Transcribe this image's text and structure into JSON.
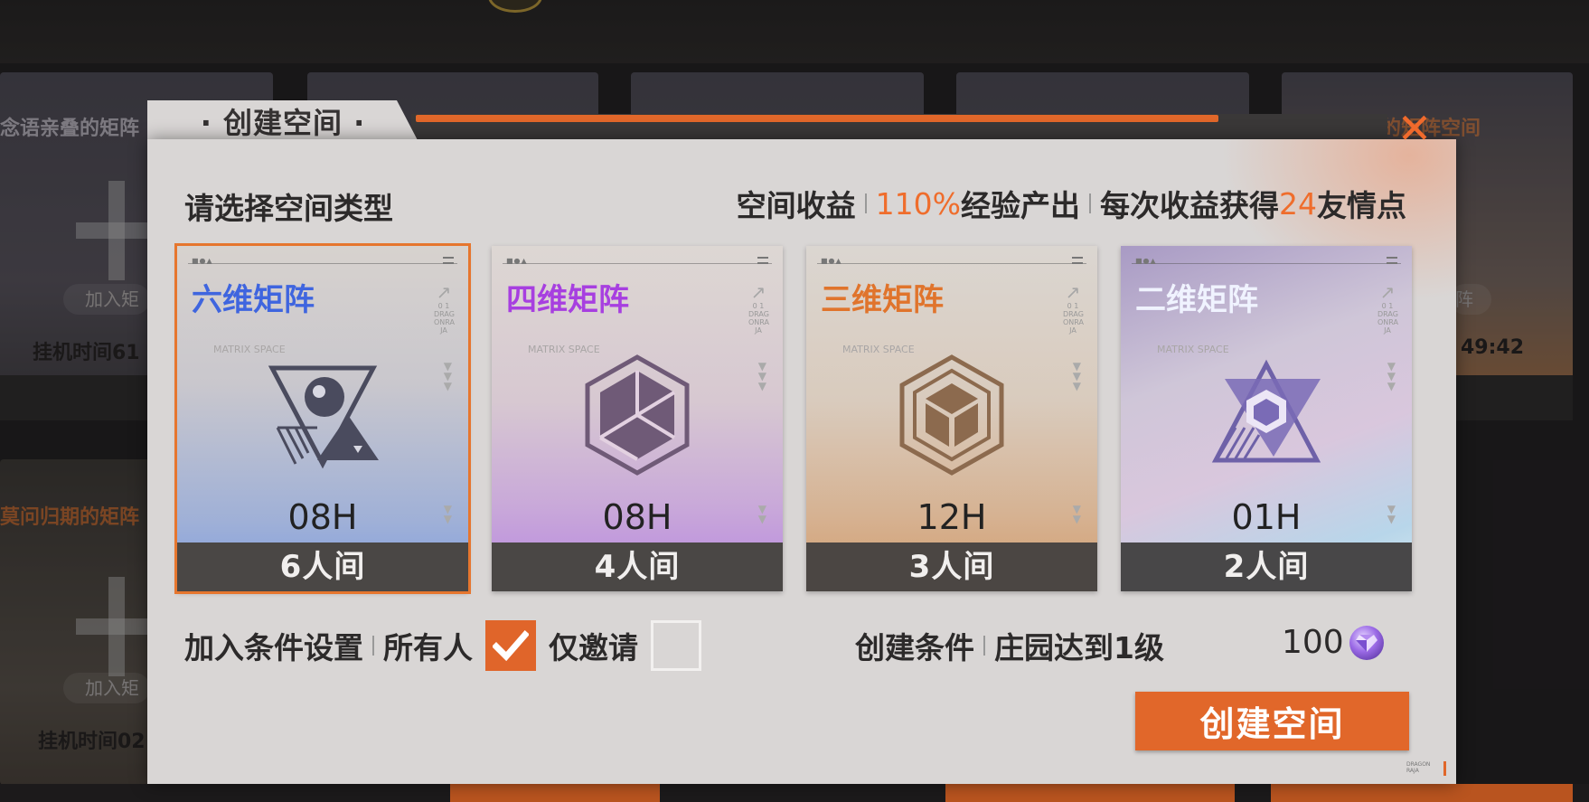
{
  "background": {
    "cards": [
      {
        "title": "念语亲叠的矩阵",
        "join_label": "加入矩",
        "time_label": "挂机时间61"
      },
      {
        "title": "莫问归期的矩阵",
        "join_label": "加入矩",
        "time_label": "挂机时间02"
      },
      {
        "title": "树下摇曳的矩阵空间",
        "join_label": "阵",
        "time_label": "49:42"
      }
    ]
  },
  "modal": {
    "tab_title": "· 创建空间 ·",
    "close_symbol": "✕",
    "select_type_label": "请选择空间类型",
    "benefit": {
      "label": "空间收益",
      "exp_value": "110%",
      "exp_label": "经验产出",
      "friend_prefix": "每次收益获得",
      "friend_value": "24",
      "friend_suffix": "友情点"
    },
    "cards": [
      {
        "name": "六维矩阵",
        "hours": "08H",
        "capacity": "6人间",
        "selected": true
      },
      {
        "name": "四维矩阵",
        "hours": "08H",
        "capacity": "4人间",
        "selected": false
      },
      {
        "name": "三维矩阵",
        "hours": "12H",
        "capacity": "3人间",
        "selected": false
      },
      {
        "name": "二维矩阵",
        "hours": "01H",
        "capacity": "2人间",
        "selected": false
      }
    ],
    "card_matrix_text": "MATRIX SPACE",
    "card_side_text": [
      "0 1",
      "DRAG",
      "ONRA",
      "JA"
    ],
    "join_settings": {
      "label": "加入条件设置",
      "option_all": "所有人",
      "option_all_checked": true,
      "option_invite": "仅邀请",
      "option_invite_checked": false
    },
    "create_condition": {
      "label": "创建条件",
      "value": "庄园达到1级"
    },
    "cost": {
      "amount": "100",
      "currency_icon": "diamond-gem-icon"
    },
    "create_button": "创建空间",
    "brand_lines": [
      "DRAGON",
      "RAJA"
    ]
  },
  "colors": {
    "accent": "#e1672a",
    "six_dim": "#3f65df",
    "four_dim": "#a73fe0",
    "three_dim": "#e0742c",
    "two_dim": "#f0f3ff"
  }
}
